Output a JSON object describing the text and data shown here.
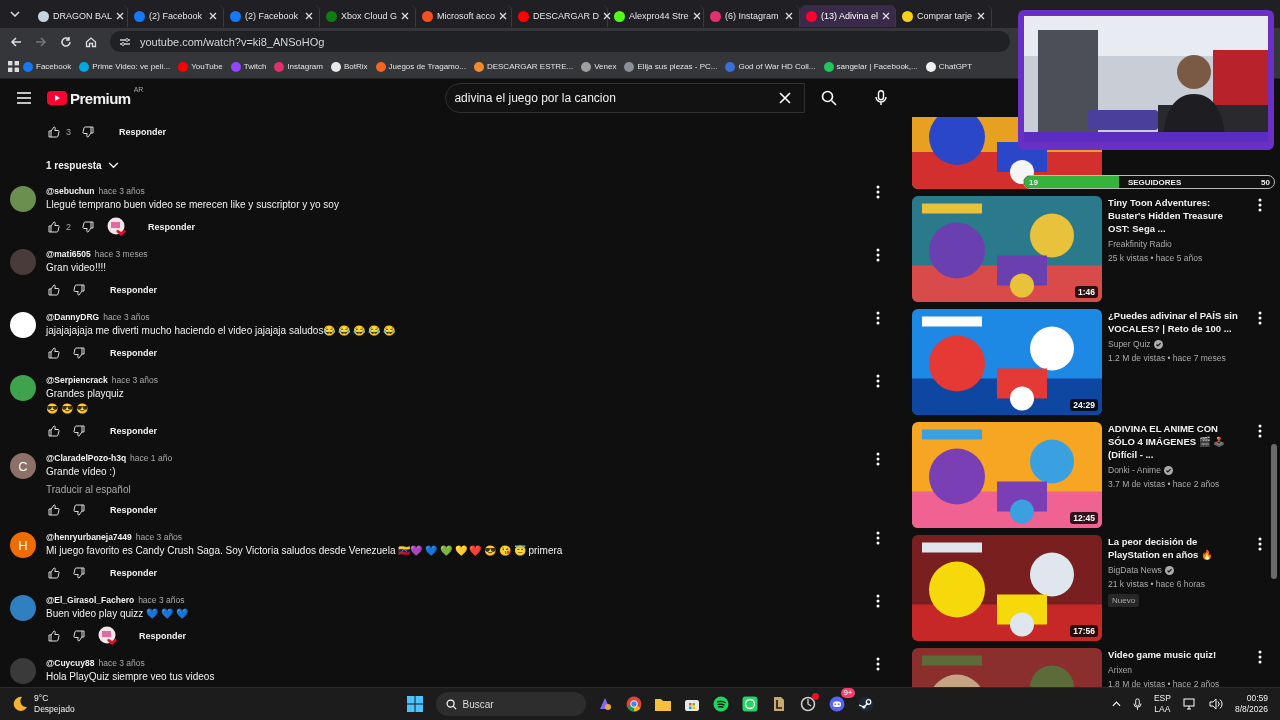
{
  "browser": {
    "tabs": [
      {
        "title": "DRAGON BAL",
        "color": "#c7d5e0",
        "selected": false
      },
      {
        "title": "(2) Facebook",
        "color": "#1877f2",
        "selected": false
      },
      {
        "title": "(2) Facebook",
        "color": "#1877f2",
        "selected": false
      },
      {
        "title": "Xbox Cloud G",
        "color": "#107c10",
        "selected": false
      },
      {
        "title": "Microsoft acco",
        "color": "#f25022",
        "selected": false
      },
      {
        "title": "DESCARGAR D",
        "color": "#ff0000",
        "selected": false
      },
      {
        "title": "Alexpro44 Stre",
        "color": "#53fc18",
        "selected": false
      },
      {
        "title": "(6) Instagram",
        "color": "#e1306c",
        "selected": false
      },
      {
        "title": "(13) Adivina el",
        "color": "#ff0033",
        "selected": true
      },
      {
        "title": "Comprar tarje",
        "color": "#f7d117",
        "selected": false
      }
    ],
    "url": "youtube.com/watch?v=ki8_ANSoHOg",
    "bookmarks": [
      {
        "label": "Facebook",
        "color": "#1877f2"
      },
      {
        "label": "Prime Video: ve pelí...",
        "color": "#00a8e1"
      },
      {
        "label": "YouTube",
        "color": "#ff0000"
      },
      {
        "label": "Twitch",
        "color": "#9146ff"
      },
      {
        "label": "Instagram",
        "color": "#e1306c"
      },
      {
        "label": "BotRix",
        "color": "#e8e8e8"
      },
      {
        "label": "Juegos de Tragamo...",
        "color": "#f26522"
      },
      {
        "label": "DESCARGAR ESTRE...",
        "color": "#f28c28"
      },
      {
        "label": "Venex",
        "color": "#9e9e9e"
      },
      {
        "label": "Elija sus piezas - PC...",
        "color": "#8a8f98"
      },
      {
        "label": "God of War HD Coll...",
        "color": "#3b6fd8"
      },
      {
        "label": "sangelar | Facebook,...",
        "color": "#22c55e"
      },
      {
        "label": "ChatGPT",
        "color": "#f0f0f0"
      }
    ]
  },
  "youtube": {
    "logo": "Premium",
    "region": "AR",
    "search": {
      "value": "adivina el juego por la cancion"
    }
  },
  "thread_tail": {
    "likes": "3",
    "reply": "Responder"
  },
  "replies_toggle": "1 respuesta",
  "comments": [
    {
      "author": "@sebuchun",
      "time": "hace 3 años",
      "lines": [
        "Llegué temprano buen video se merecen like y suscriptor y yo soy"
      ],
      "likes": "2",
      "creator_heart": true,
      "color": "#6b8f4e",
      "reply": "Responder"
    },
    {
      "author": "@mati6505",
      "time": "hace 3 meses",
      "lines": [
        "Gran video!!!!"
      ],
      "creator_heart": false,
      "color": "#4a3b3b",
      "reply": "Responder"
    },
    {
      "author": "@DannyDRG",
      "time": "hace 3 años",
      "lines": [
        "jajajajajaja me diverti mucho haciendo el video jajajaja saludos😂 😂 😂 😂 😂"
      ],
      "creator_heart": false,
      "color": "#ffffff",
      "reply": "Responder"
    },
    {
      "author": "@Serpiencrack",
      "time": "hace 3 años",
      "lines": [
        "Grandes playquiz",
        "😎 😎 😎"
      ],
      "creator_heart": false,
      "color": "#3fa34d",
      "reply": "Responder"
    },
    {
      "author": "@ClaradelPozo-h3q",
      "time": "hace 1 año",
      "lines": [
        "Grande vídeo :)"
      ],
      "translate": "Traducir al español",
      "initial": "C",
      "creator_heart": false,
      "color": "#8d7068",
      "reply": "Responder"
    },
    {
      "author": "@henryurbaneja7449",
      "time": "hace 3 años",
      "lines": [
        "Mi juego favorito es Candy Crush Saga. Soy Victoria saludos desde Venezuela 🇻🇪💜 💙 💚 💛 ❤️ 😎 😘 😇 primera"
      ],
      "initial": "H",
      "creator_heart": false,
      "color": "#ef6c00",
      "reply": "Responder"
    },
    {
      "author": "@El_Girasol_Fachero",
      "time": "hace 3 años",
      "lines": [
        "Buen video play quizz 💙 💙 💙"
      ],
      "creator_heart": true,
      "color": "#2f7fc1",
      "reply": "Responder"
    },
    {
      "author": "@Cuycuy88",
      "time": "hace 3 años",
      "lines": [
        "Hola PlayQuiz siempre veo tus videos"
      ],
      "color": "#3a3a3a"
    }
  ],
  "sidebar": {
    "videos": [
      {
        "title": "Tiny Toon Adventures: Buster's Hidden Treasure OST: Sega ...",
        "channel": "Freakfinity Radio",
        "verified": false,
        "meta": "25 k vistas • hace 5 años",
        "duration": "1:46"
      },
      {
        "title": "¿Puedes adivinar el PAÍS sin VOCALES? | Reto de 100 ...",
        "channel": "Super Quiz",
        "verified": true,
        "meta": "1.2 M de vistas • hace 7 meses",
        "duration": "24:29"
      },
      {
        "title": "ADIVINA EL ANIME CON SÓLO 4 IMÁGENES 🎬 🕹️ (Difícil - ...",
        "channel": "Donki - Anime",
        "verified": true,
        "meta": "3.7 M de vistas • hace 2 años",
        "duration": "12:45"
      },
      {
        "title": "La peor decisión de PlayStation en años 🔥",
        "channel": "BigData News",
        "verified": true,
        "meta": "21 k vistas • hace 6 horas",
        "duration": "17:56",
        "badge": "Nuevo"
      },
      {
        "title": "Video game music quiz!",
        "channel": "Arixen",
        "verified": false,
        "meta": "1.8 M de vistas • hace 2 años"
      }
    ]
  },
  "overlay_goal": {
    "current": "19",
    "label": "SEGUIDORES",
    "target": "50",
    "level": 0.38
  },
  "taskbar": {
    "temperature": "9°C",
    "weather": "Despejado",
    "search": {
      "placeholder": "Buscar"
    },
    "chat_badge": "9+",
    "language": "ESP",
    "layout": "LAA",
    "time": "00:59",
    "date": "8/8/2026"
  }
}
